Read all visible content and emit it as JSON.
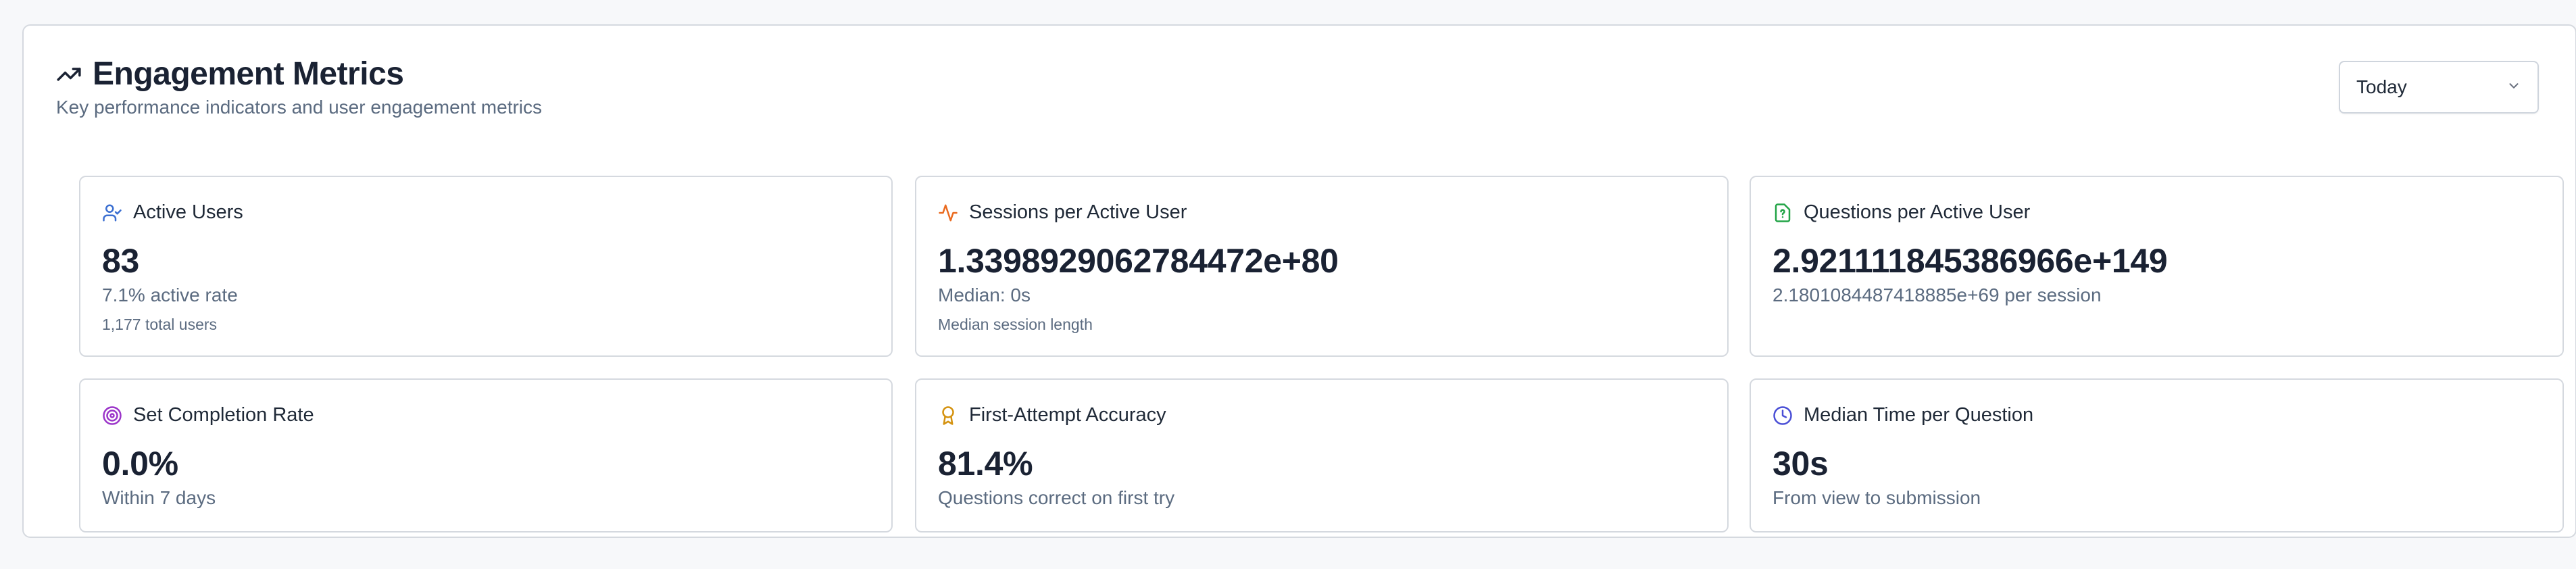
{
  "header": {
    "title": "Engagement Metrics",
    "subtitle": "Key performance indicators and user engagement metrics",
    "title_icon": "trending-up-icon"
  },
  "range_select": {
    "value": "Today"
  },
  "cards": [
    {
      "title": "Active Users",
      "icon": "user-check-icon",
      "icon_color": "#3b6fd1",
      "value": "83",
      "sub": "7.1% active rate",
      "note": "1,177 total users"
    },
    {
      "title": "Sessions per Active User",
      "icon": "activity-icon",
      "icon_color": "#ea6a1f",
      "value": "1.3398929062784472e+80",
      "sub": "Median: 0s",
      "note": "Median session length"
    },
    {
      "title": "Questions per Active User",
      "icon": "file-question-icon",
      "icon_color": "#22a447",
      "value": "2.921111845386966e+149",
      "sub": "2.1801084487418885e+69 per session",
      "note": ""
    },
    {
      "title": "Set Completion Rate",
      "icon": "target-icon",
      "icon_color": "#9b34c9",
      "value": "0.0%",
      "sub": "Within 7 days"
    },
    {
      "title": "First-Attempt Accuracy",
      "icon": "award-icon",
      "icon_color": "#d4920f",
      "value": "81.4%",
      "sub": "Questions correct on first try"
    },
    {
      "title": "Median Time per Question",
      "icon": "clock-icon",
      "icon_color": "#4a4fd6",
      "value": "30s",
      "sub": "From view to submission"
    }
  ]
}
